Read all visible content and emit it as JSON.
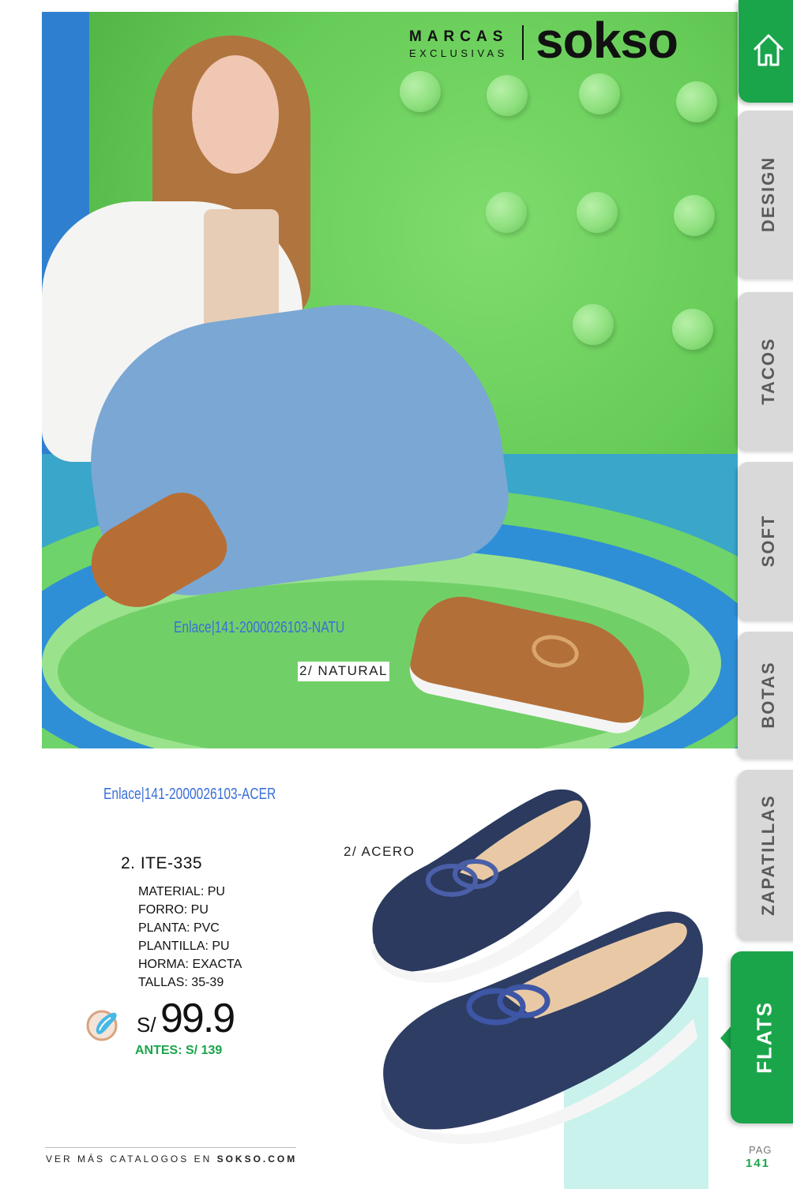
{
  "brand": {
    "marcas": "MARCAS",
    "exclusivas": "EXCLUSIVAS",
    "logo": "sokso"
  },
  "hero": {
    "link_text": "Enlace|141-2000026103-NATU",
    "color_tag": "2/ NATURAL"
  },
  "product": {
    "link_text": "Enlace|141-2000026103-ACER",
    "color_tag": "2/ ACERO",
    "code": "2. ITE-335",
    "specs": [
      "MATERIAL: PU",
      "FORRO: PU",
      "PLANTA: PVC",
      "PLANTILLA: PU",
      "HORMA: EXACTA",
      "TALLAS: 35-39"
    ],
    "price_prefix": "S/",
    "price": "99.9",
    "price_before": "ANTES: S/ 139"
  },
  "tabs": {
    "home_icon": "home-icon",
    "items": [
      {
        "label": "DESIGN"
      },
      {
        "label": "TACOS"
      },
      {
        "label": "SOFT"
      },
      {
        "label": "BOTAS"
      },
      {
        "label": "ZAPATILLAS"
      }
    ],
    "active": "FLATS"
  },
  "footer": {
    "text_prefix": "VER MÁS CATALOGOS EN ",
    "site": "SOKSO.COM",
    "pag_label": "PAG",
    "pag_num": "141"
  },
  "colors": {
    "accent_green": "#1aa54a",
    "link_blue": "#3a6fd8",
    "tab_gray": "#d9d9d9",
    "mint": "#c9f2ec"
  }
}
